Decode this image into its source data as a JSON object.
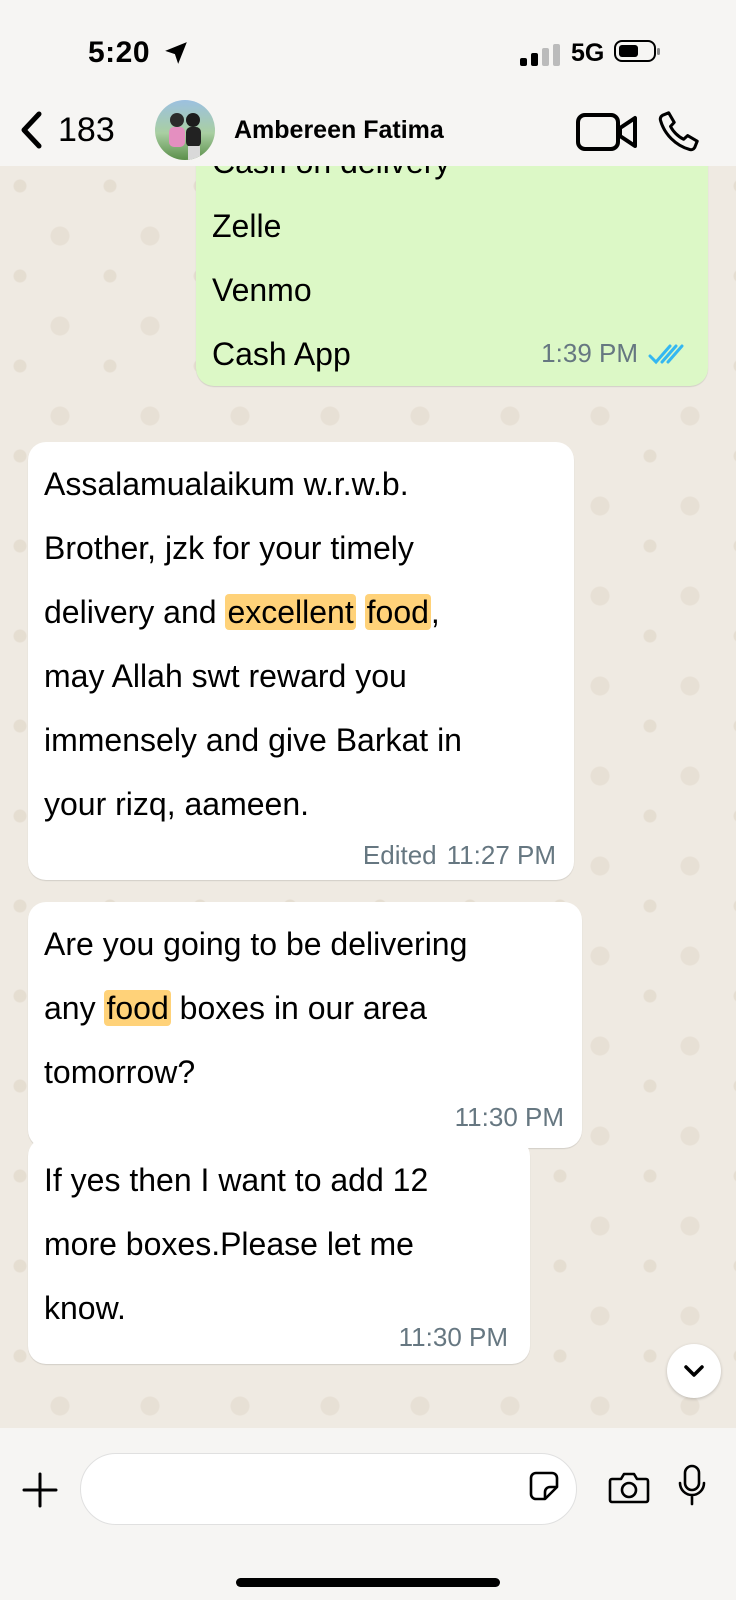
{
  "status_bar": {
    "time": "5:20",
    "network": "5G"
  },
  "header": {
    "back_count": "183",
    "contact_name": "Ambereen Fatima"
  },
  "messages": [
    {
      "direction": "outgoing",
      "lines": [
        "Cash on delivery",
        "Zelle",
        "Venmo",
        "Cash App"
      ],
      "time": "1:39 PM",
      "status": "read"
    },
    {
      "direction": "incoming",
      "lines": [
        "Assalamualaikum w.r.w.b.",
        "Brother, jzk for your timely"
      ],
      "line3": {
        "pre": "delivery and ",
        "hl1": "excellent",
        "hl2": "food",
        "post": ","
      },
      "lines_after": [
        "may Allah swt reward you",
        "immensely and give Barkat in",
        "your rizq, aameen."
      ],
      "edited": "Edited",
      "time": "11:27 PM"
    },
    {
      "direction": "incoming",
      "line1": "Are you going to be delivering",
      "line2": {
        "pre": "any ",
        "hl": "food",
        "post": " boxes in our area"
      },
      "line3": "tomorrow?",
      "time": "11:30 PM"
    },
    {
      "direction": "incoming",
      "lines": [
        "If yes then I want to add 12",
        "more boxes.Please let me",
        "know."
      ],
      "time": "11:30 PM"
    }
  ],
  "highlight_color": "#ffd279",
  "outgoing_bubble_color": "#dcf8c6",
  "read_tick_color": "#34b7f1",
  "icons": [
    "location-arrow-icon",
    "signal-icon",
    "battery-icon",
    "back-chevron-icon",
    "video-call-icon",
    "phone-icon",
    "double-check-icon",
    "chevron-down-icon",
    "plus-icon",
    "sticker-icon",
    "camera-icon",
    "microphone-icon"
  ]
}
